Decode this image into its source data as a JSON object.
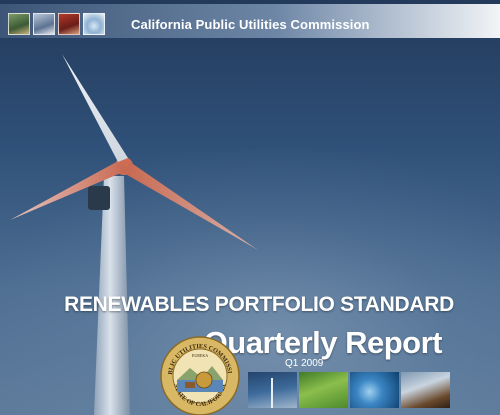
{
  "header": {
    "agency": "California Public Utilities Commission",
    "thumbnails": [
      "house-photo",
      "solar-panel-photo",
      "power-plant-photo",
      "water-drop-photo"
    ]
  },
  "cover": {
    "headline": "RENEWABLES PORTFOLIO STANDARD",
    "subhead": "Quarterly Report",
    "period": "Q1 2009"
  },
  "seal": {
    "top_text": "PUBLIC UTILITIES COMMISSION",
    "bottom_text": "STATE OF CALIFORNIA",
    "motto": "EUREKA"
  },
  "photo_strip": [
    "wind-turbine-photo",
    "grass-photo",
    "water-photo",
    "geothermal-photo"
  ],
  "colors": {
    "sky_dark": "#233a5b",
    "sky_light": "#5f7c9c",
    "blade": "#b8625a",
    "title_text": "#ffffff"
  }
}
